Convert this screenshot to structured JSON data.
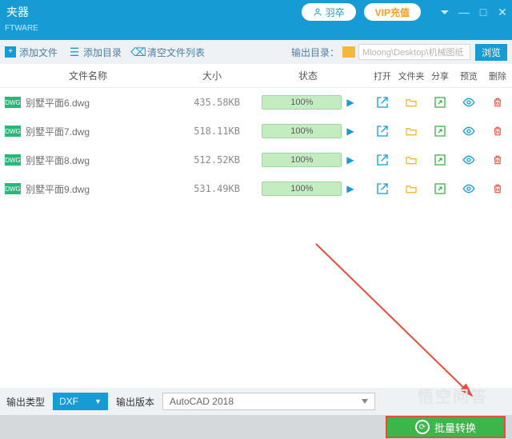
{
  "title": "夹器",
  "subtitle": "FTWARE",
  "user": {
    "name": "羽卒"
  },
  "vip": "VIP充值",
  "toolbar": {
    "add_file": "添加文件",
    "add_folder": "添加目录",
    "clear_list": "清空文件列表",
    "output_dir_label": "输出目录：",
    "output_path": "Mloong\\Desktop\\机械图纸",
    "browse": "浏览"
  },
  "columns": {
    "name": "文件名称",
    "size": "大小",
    "status": "状态",
    "open": "打开",
    "folder": "文件夹",
    "share": "分享",
    "preview": "预览",
    "delete": "删除"
  },
  "badge": "DWG",
  "progress": "100%",
  "files": [
    {
      "name": "别墅平面6.dwg",
      "size": "435.58KB"
    },
    {
      "name": "别墅平面7.dwg",
      "size": "518.11KB"
    },
    {
      "name": "别墅平面8.dwg",
      "size": "512.52KB"
    },
    {
      "name": "别墅平面9.dwg",
      "size": "531.49KB"
    }
  ],
  "output": {
    "type_label": "输出类型",
    "type_value": "DXF",
    "version_label": "输出版本",
    "version_value": "AutoCAD 2018"
  },
  "convert": "批量转换",
  "watermark": "悟空问答"
}
